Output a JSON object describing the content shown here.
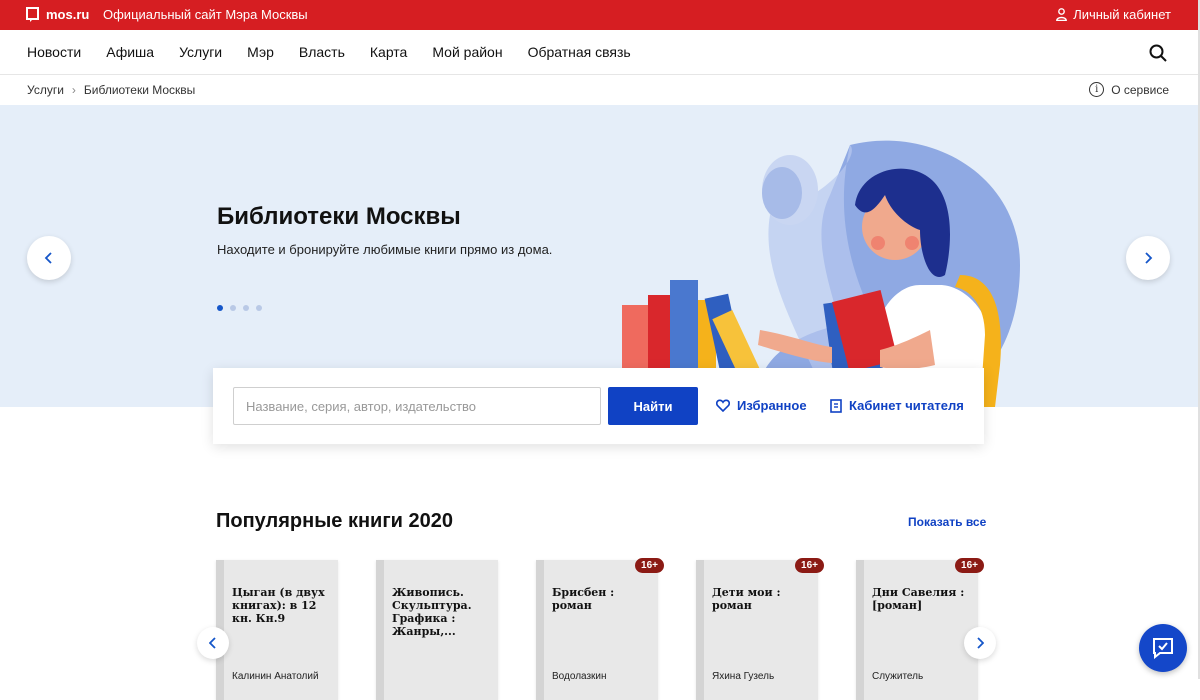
{
  "topbar": {
    "logo": "mos.ru",
    "site_title": "Официальный сайт Мэра Москвы",
    "cabinet": "Личный кабинет"
  },
  "nav": {
    "items": [
      "Новости",
      "Афиша",
      "Услуги",
      "Мэр",
      "Власть",
      "Карта",
      "Мой район",
      "Обратная связь"
    ]
  },
  "breadcrumbs": {
    "items": [
      "Услуги",
      "Библиотеки Москвы"
    ],
    "separator": "›",
    "about": "О сервисе"
  },
  "hero": {
    "title": "Библиотеки Москвы",
    "subtitle": "Находите и бронируйте любимые книги прямо из дома.",
    "slide_count": 4,
    "active_slide": 1
  },
  "search": {
    "placeholder": "Название, серия, автор, издательство",
    "button": "Найти",
    "favorites": "Избранное",
    "reader_cabinet": "Кабинет читателя"
  },
  "popular": {
    "title": "Популярные книги 2020",
    "show_all": "Показать все",
    "books": [
      {
        "title": "Цыган (в двух книгах): в 12 кн. Кн.9",
        "author": "Калинин Анатолий",
        "age": ""
      },
      {
        "title": "Живопись. Скульптура. Графика : Жанры,...",
        "author": "",
        "age": ""
      },
      {
        "title": "Брисбен : роман",
        "author": "Водолазкин",
        "age": "16+"
      },
      {
        "title": "Дети мои : роман",
        "author": "Яхина Гузель",
        "age": "16+"
      },
      {
        "title": "Дни Савелия : [роман]",
        "author": "Служитель",
        "age": "16+"
      }
    ]
  },
  "colors": {
    "brand_red": "#d61e22",
    "accent_blue": "#1042c4",
    "hero_bg": "#e5eef9"
  }
}
